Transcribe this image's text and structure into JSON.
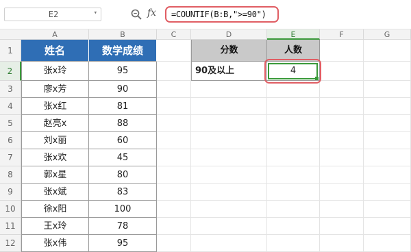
{
  "formula_bar": {
    "name_box": "E2",
    "fx_label": "fx",
    "formula": "=COUNTIF(B:B,\">=90\")"
  },
  "columns": [
    "A",
    "B",
    "C",
    "D",
    "E",
    "F",
    "G"
  ],
  "active_column": "E",
  "rows": [
    "1",
    "2",
    "3",
    "4",
    "5",
    "6",
    "7",
    "8",
    "9",
    "10",
    "11",
    "12"
  ],
  "active_row": "2",
  "table1": {
    "headers": [
      "姓名",
      "数学成绩"
    ],
    "rows": [
      [
        "张x玲",
        "95"
      ],
      [
        "廖x芳",
        "90"
      ],
      [
        "张x红",
        "81"
      ],
      [
        "赵亮x",
        "88"
      ],
      [
        "刘x丽",
        "60"
      ],
      [
        "张x欢",
        "45"
      ],
      [
        "郭x星",
        "80"
      ],
      [
        "张x斌",
        "83"
      ],
      [
        "徐x阳",
        "100"
      ],
      [
        "王x玲",
        "78"
      ],
      [
        "张x伟",
        "95"
      ]
    ]
  },
  "table2": {
    "headers": [
      "分数",
      "人数"
    ],
    "row_label": "90及以上",
    "row_value": "4"
  },
  "colors": {
    "header_blue": "#2f6eb5",
    "header_gray": "#c9c9c9",
    "selection_green": "#3a9a3a",
    "highlight_red": "#e05d63"
  }
}
